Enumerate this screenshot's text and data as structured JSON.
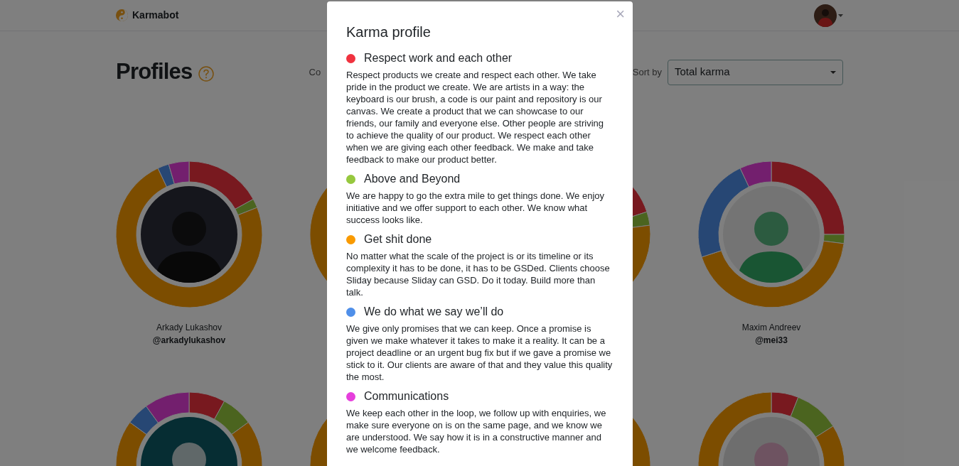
{
  "navbar": {
    "brand": "Karmabot"
  },
  "page": {
    "title": "Profiles",
    "filter_label": "Co",
    "sort_label": "Sort by",
    "sort_value": "Total karma"
  },
  "profiles": [
    {
      "name": "Arkady Lukashov",
      "handle": "@arkadylukashov"
    },
    {
      "name": "Maxim Andreev",
      "handle": "@mei33"
    }
  ],
  "modal": {
    "title": "Karma profile",
    "close": "×",
    "values": [
      {
        "title": "Respect work and each other",
        "color": "#f0323f",
        "text": "Respect products we create and respect each other. We take pride in the product we create. We are artists in a way: the keyboard is our brush, a code is our paint and repository is our canvas. We create a product that we can showcase to our friends, our family and everyone else. Other people are striving to achieve the quality of our product. We respect each other when we are giving each other feedback. We make and take feedback to make our product better."
      },
      {
        "title": "Above and Beyond",
        "color": "#96c83e",
        "text": "We are happy to go the extra mile to get things done. We enjoy initiative and we offer support to each other. We know what success looks like."
      },
      {
        "title": "Get shit done",
        "color": "#f99a00",
        "text": "No matter what the scale of the project is or its timeline or its complexity it has to be done, it has to be GSDed. Clients choose Sliday because Sliday can GSD. Do it today. Build more than talk."
      },
      {
        "title": "We do what we say we’ll do",
        "color": "#4f8fe9",
        "text": "We give only promises that we can keep. Once a promise is given we make whatever it takes to make it a reality. It can be a project deadline or an urgent bug fix but if we gave a promise we stick to it. Our clients are aware of that and they value this quality the most."
      },
      {
        "title": "Communications",
        "color": "#e63fdc",
        "text": "We keep each other in the loop, we follow up with enquiries, we make sure everyone on is on the same page, and we know we are understood. We say how it is in a constructive manner and we welcome feedback."
      }
    ]
  }
}
